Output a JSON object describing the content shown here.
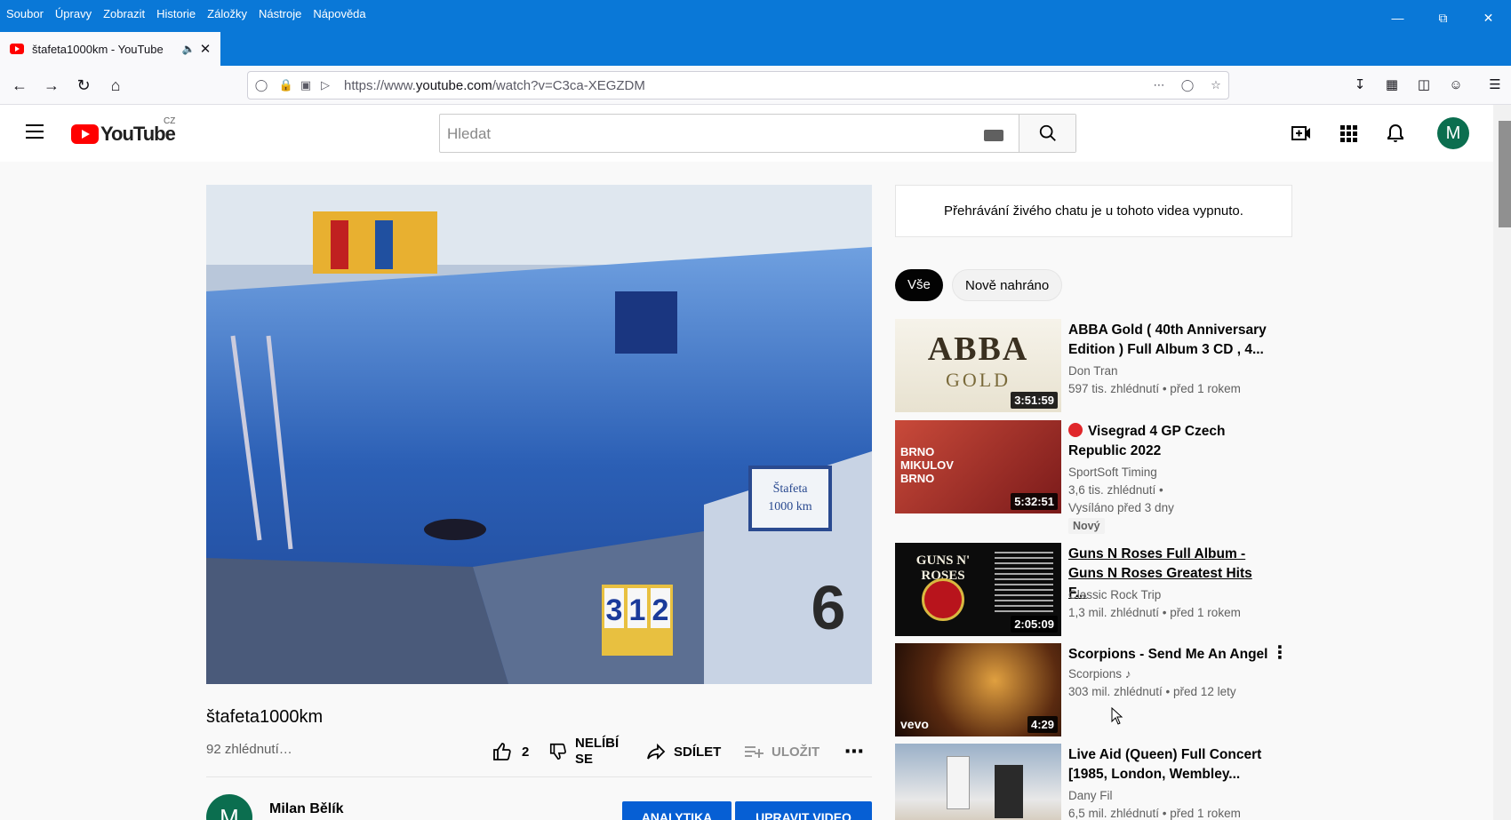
{
  "browser": {
    "menu": [
      "Soubor",
      "Úpravy",
      "Zobrazit",
      "Historie",
      "Záložky",
      "Nástroje",
      "Nápověda"
    ],
    "tab_title": "štafeta1000km - YouTube",
    "url_prefix": "https://www.",
    "url_host": "youtube.com",
    "url_path": "/watch?v=C3ca-XEGZDM"
  },
  "youtube": {
    "logo_word": "YouTube",
    "country": "CZ",
    "search_placeholder": "Hledat",
    "avatar_letter": "M"
  },
  "video": {
    "title": "štafeta1000km",
    "views": "92 zhlédnutí…",
    "likes": "2",
    "dislike_label_1": "NELÍBÍ",
    "dislike_label_2": "SE",
    "share_label": "SDÍLET",
    "save_label": "ULOŽIT",
    "owner_name": "Milan Bělík",
    "owner_avatar_letter": "M",
    "analytics_button": "ANALYTIKA",
    "edit_button": "UPRAVIT VIDEO",
    "board_sign_line1": "Štafeta",
    "board_sign_line2": "1000 km",
    "counter_digits": [
      "3",
      "1",
      "2"
    ],
    "lane_number": "6"
  },
  "sidebar": {
    "chat_notice": "Přehrávání živého chatu je u tohoto videa vypnuto.",
    "chips": [
      "Vše",
      "Nově nahráno"
    ],
    "recommendations": [
      {
        "title_line1": "ABBA Gold ( 40th Anniversary",
        "title_line2": "Edition ) Full Album 3 CD , 4...",
        "channel": "Don Tran",
        "stats": "597 tis. zhlédnutí • před 1 rokem",
        "duration": "3:51:59",
        "thumb_text1": "ABBA",
        "thumb_text2": "GOLD"
      },
      {
        "title_line1": "Visegrad 4 GP Czech",
        "title_line2": "Republic 2022",
        "channel": "SportSoft Timing",
        "stats": "3,6 tis. zhlédnutí •",
        "stats2": "Vysíláno před 3 dny",
        "badge": "Nový",
        "duration": "5:32:51",
        "thumb_text1": "BRNO",
        "thumb_text2": "MIKULOV",
        "thumb_text3": "BRNO"
      },
      {
        "title_line1": "Guns N Roses Full Album -",
        "title_line2": "Guns N Roses Greatest Hits F...",
        "channel": "Classic Rock Trip",
        "stats": "1,3 mil. zhlédnutí • před 1 rokem",
        "duration": "2:05:09",
        "thumb_text1": "GUNS N' ROSES"
      },
      {
        "title_line1": "Scorpions - Send Me An Angel",
        "channel": "Scorpions",
        "stats": "303 mil. zhlédnutí • před 12 lety",
        "duration": "4:29",
        "thumb_text1": "vevo"
      },
      {
        "title_line1": "Live Aid (Queen) Full Concert",
        "title_line2": "[1985, London, Wembley...",
        "channel": "Dany Fil",
        "stats": "6,5 mil. zhlédnutí • před 1 rokem"
      }
    ]
  },
  "colors": {
    "browser_blue": "#0a78d7",
    "youtube_red": "#ff0000",
    "action_blue": "#065fd4",
    "avatar_green": "#0b6e4f"
  }
}
